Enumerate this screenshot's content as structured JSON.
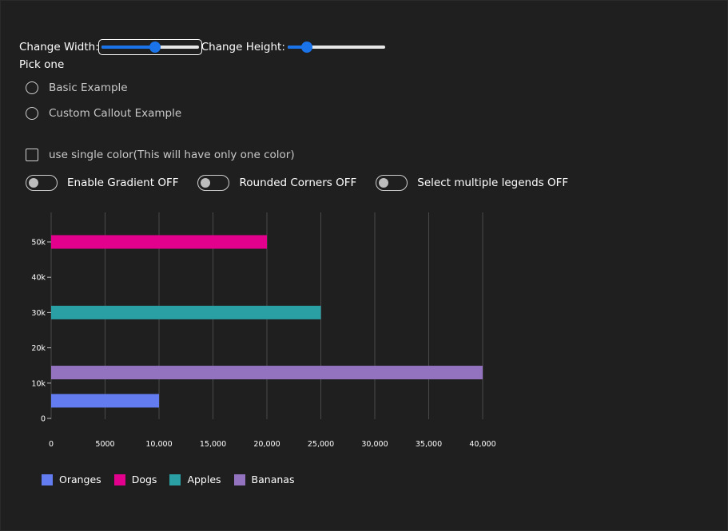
{
  "controls": {
    "width_label": "Change Width:",
    "height_label": "Change Height:",
    "width_value": 0.55,
    "height_value": 0.2,
    "pick_label": "Pick one",
    "radio_basic": "Basic Example",
    "radio_custom": "Custom Callout Example",
    "single_color_label": "use single color(This will have only one color)",
    "gradient_label": "Enable Gradient OFF",
    "rounded_label": "Rounded Corners OFF",
    "multi_legend_label": "Select multiple legends OFF"
  },
  "chart_data": {
    "type": "bar",
    "orientation": "horizontal",
    "x_ticks": [
      "0",
      "5000",
      "10,000",
      "15,000",
      "20,000",
      "25,000",
      "30,000",
      "35,000",
      "40,000"
    ],
    "y_ticks": [
      "0",
      "10k",
      "20k",
      "30k",
      "40k",
      "50k"
    ],
    "xlim": [
      0,
      40000
    ],
    "ylim": [
      0,
      50000
    ],
    "grid": "vertical",
    "series": [
      {
        "name": "Oranges",
        "x": 10000,
        "y": 5000,
        "color": "#637cef"
      },
      {
        "name": "Dogs",
        "x": 20000,
        "y": 50000,
        "color": "#e3008c"
      },
      {
        "name": "Apples",
        "x": 25000,
        "y": 30000,
        "color": "#2aa0a4"
      },
      {
        "name": "Bananas",
        "x": 40000,
        "y": 13000,
        "color": "#9373c0"
      }
    ],
    "legend": [
      {
        "name": "Oranges",
        "color": "#637cef"
      },
      {
        "name": "Dogs",
        "color": "#e3008c"
      },
      {
        "name": "Apples",
        "color": "#2aa0a4"
      },
      {
        "name": "Bananas",
        "color": "#9373c0"
      }
    ],
    "legend_position": "bottom-left"
  }
}
